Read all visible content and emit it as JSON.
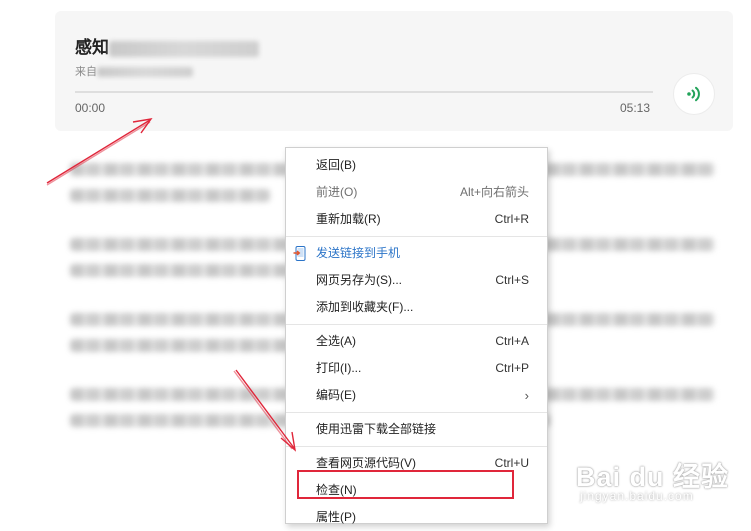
{
  "audio": {
    "title_prefix": "感知",
    "title_rest_hidden": "觉...",
    "source_prefix": "来自",
    "time_current": "00:00",
    "time_total": "05:13",
    "progress": 0,
    "accent_color": "#22a35a",
    "play_icon": "sound-wave-icon"
  },
  "context_menu": {
    "items": [
      {
        "label": "返回(B)",
        "shortcut": "",
        "state": "normal"
      },
      {
        "label": "前进(O)",
        "shortcut": "Alt+向右箭头",
        "state": "disabled"
      },
      {
        "label": "重新加载(R)",
        "shortcut": "Ctrl+R",
        "state": "normal"
      },
      {
        "label": "发送链接到手机",
        "shortcut": "",
        "state": "link",
        "icon": "phone-send-icon"
      },
      {
        "label": "网页另存为(S)...",
        "shortcut": "Ctrl+S",
        "state": "normal"
      },
      {
        "label": "添加到收藏夹(F)...",
        "shortcut": "",
        "state": "normal"
      },
      {
        "label": "全选(A)",
        "shortcut": "Ctrl+A",
        "state": "normal"
      },
      {
        "label": "打印(I)...",
        "shortcut": "Ctrl+P",
        "state": "normal"
      },
      {
        "label": "编码(E)",
        "shortcut": "",
        "state": "normal",
        "submenu": true
      },
      {
        "label": "使用迅雷下载全部链接",
        "shortcut": "",
        "state": "normal"
      },
      {
        "label": "查看网页源代码(V)",
        "shortcut": "Ctrl+U",
        "state": "normal"
      },
      {
        "label": "检查(N)",
        "shortcut": "",
        "state": "normal",
        "highlighted": true
      },
      {
        "label": "属性(P)",
        "shortcut": "",
        "state": "normal"
      }
    ],
    "highlight_color": "#e0263a"
  },
  "annotation": {
    "arrow_color": "#e0263a"
  },
  "watermark": {
    "brand": "Bai du 经验",
    "sub": "jingyan.baidu.com"
  }
}
